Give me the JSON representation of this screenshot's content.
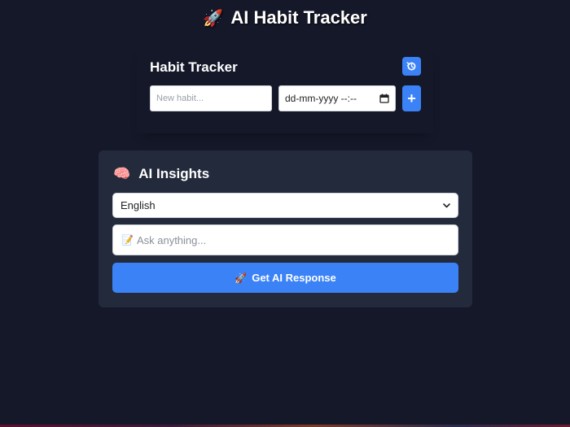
{
  "header": {
    "emoji": "🚀",
    "title": "AI Habit Tracker"
  },
  "habit_tracker": {
    "title": "Habit Tracker",
    "history_icon": "history-icon",
    "input_placeholder": "New habit...",
    "datetime_placeholder": "dd-mm-yyyy --:--",
    "calendar_icon": "calendar-icon",
    "add_label": "+"
  },
  "ai_insights": {
    "emoji": "🧠",
    "title": "AI Insights",
    "language_selected": "English",
    "ask_emoji": "📝",
    "ask_placeholder": "Ask anything...",
    "button_emoji": "🚀",
    "button_label": "Get AI Response"
  },
  "colors": {
    "background": "#151829",
    "card": "#232a3b",
    "accent": "#3b82f6"
  }
}
